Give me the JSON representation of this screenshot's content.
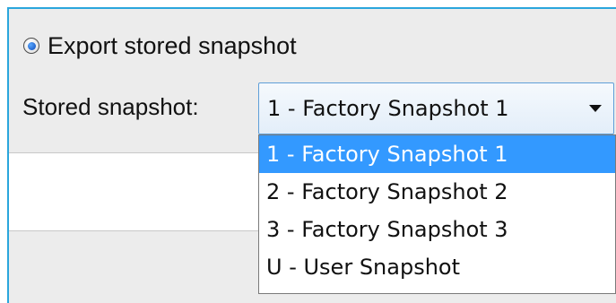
{
  "export_option": {
    "radio_label": "Export stored snapshot",
    "selected": true
  },
  "snapshot_field": {
    "label": "Stored snapshot:",
    "selected_value": "1 - Factory Snapshot 1",
    "options": [
      {
        "label": "1 - Factory Snapshot 1",
        "highlighted": true
      },
      {
        "label": "2 - Factory Snapshot 2",
        "highlighted": false
      },
      {
        "label": "3 - Factory Snapshot 3",
        "highlighted": false
      },
      {
        "label": "U - User Snapshot",
        "highlighted": false
      }
    ]
  },
  "icons": {
    "dropdown": "chevron-down-icon",
    "radio": "radio-selected-icon"
  },
  "colors": {
    "panel_background": "#ececec",
    "panel_border": "#2aa6dc",
    "highlight": "#3399ff",
    "select_border": "#5f9fd8"
  }
}
